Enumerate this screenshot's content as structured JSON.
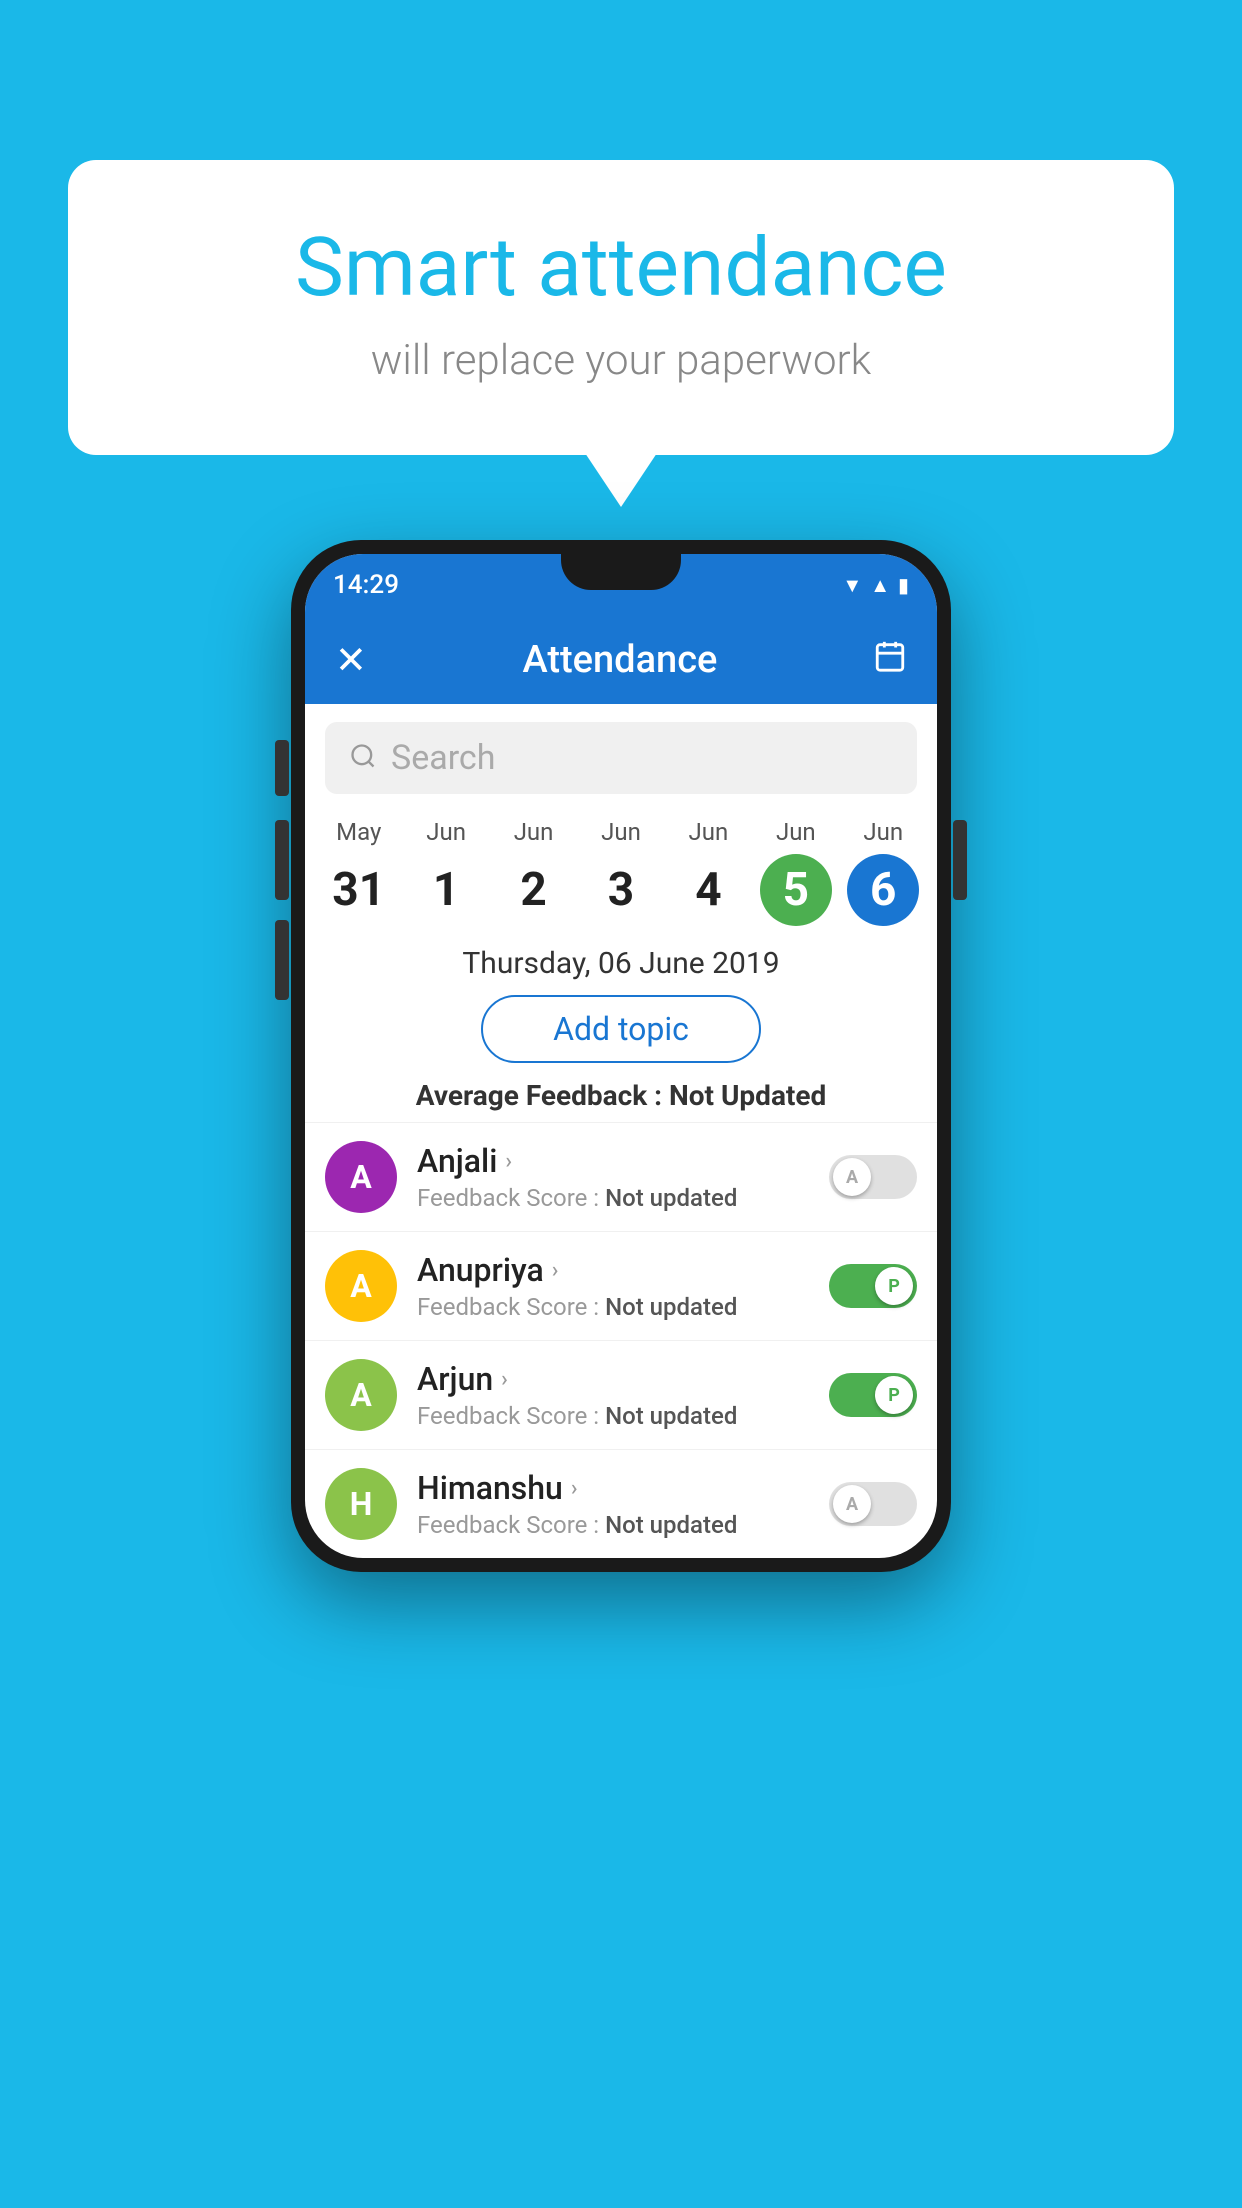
{
  "background_color": "#1ab8e8",
  "speech_bubble": {
    "title": "Smart attendance",
    "subtitle": "will replace your paperwork"
  },
  "phone": {
    "status_bar": {
      "time": "14:29"
    },
    "header": {
      "close_label": "✕",
      "title": "Attendance",
      "calendar_icon": "📅"
    },
    "search": {
      "placeholder": "Search"
    },
    "calendar": {
      "days": [
        {
          "month": "May",
          "date": "31",
          "style": "normal"
        },
        {
          "month": "Jun",
          "date": "1",
          "style": "normal"
        },
        {
          "month": "Jun",
          "date": "2",
          "style": "normal"
        },
        {
          "month": "Jun",
          "date": "3",
          "style": "normal"
        },
        {
          "month": "Jun",
          "date": "4",
          "style": "normal"
        },
        {
          "month": "Jun",
          "date": "5",
          "style": "green"
        },
        {
          "month": "Jun",
          "date": "6",
          "style": "blue"
        }
      ]
    },
    "selected_date": "Thursday, 06 June 2019",
    "add_topic_label": "Add topic",
    "average_feedback_label": "Average Feedback :",
    "average_feedback_value": "Not Updated",
    "students": [
      {
        "name": "Anjali",
        "avatar_letter": "A",
        "avatar_color": "#9c27b0",
        "feedback_label": "Feedback Score :",
        "feedback_value": "Not updated",
        "toggle_state": "off",
        "toggle_label": "A"
      },
      {
        "name": "Anupriya",
        "avatar_letter": "A",
        "avatar_color": "#ffc107",
        "feedback_label": "Feedback Score :",
        "feedback_value": "Not updated",
        "toggle_state": "on",
        "toggle_label": "P"
      },
      {
        "name": "Arjun",
        "avatar_letter": "A",
        "avatar_color": "#8bc34a",
        "feedback_label": "Feedback Score :",
        "feedback_value": "Not updated",
        "toggle_state": "on",
        "toggle_label": "P"
      },
      {
        "name": "Himanshu",
        "avatar_letter": "H",
        "avatar_color": "#8bc34a",
        "feedback_label": "Feedback Score :",
        "feedback_value": "Not updated",
        "toggle_state": "off",
        "toggle_label": "A"
      }
    ]
  }
}
